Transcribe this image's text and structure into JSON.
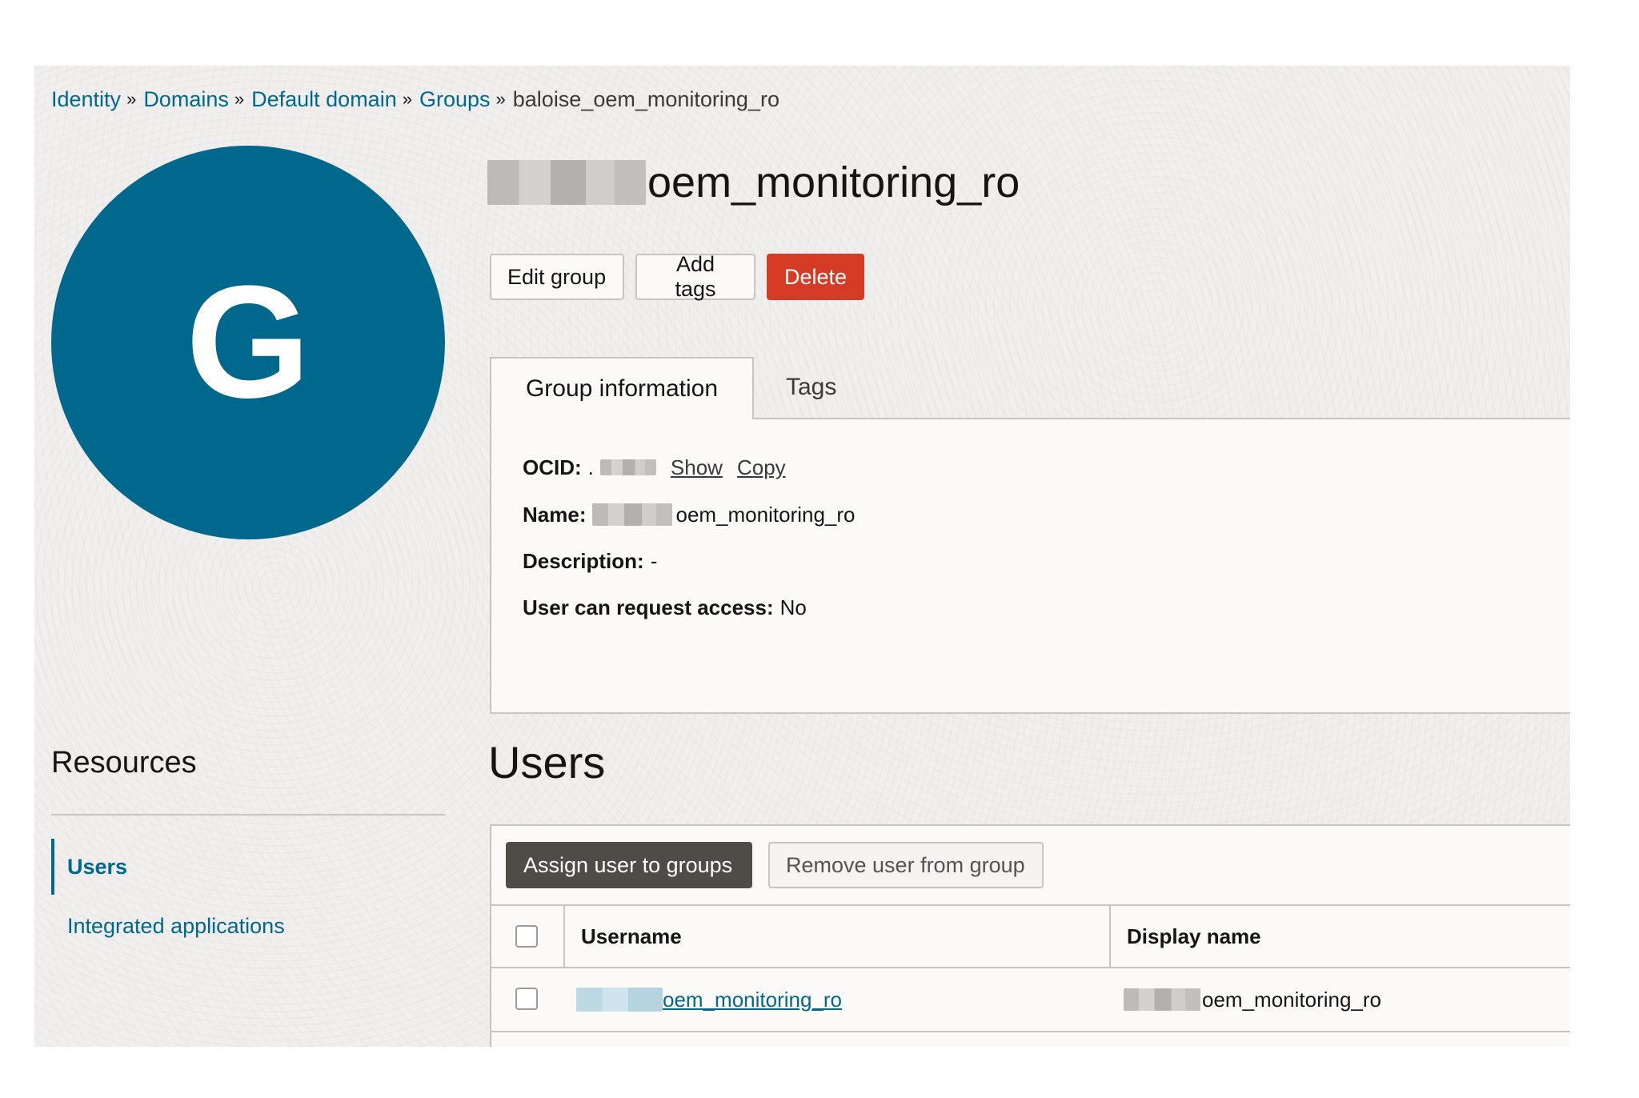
{
  "breadcrumb": {
    "items": [
      "Identity",
      "Domains",
      "Default domain",
      "Groups"
    ],
    "current": "baloise_oem_monitoring_ro",
    "separator": "»"
  },
  "avatar": {
    "letter": "G",
    "color": "#00688c"
  },
  "group": {
    "title_visible": "oem_monitoring_ro"
  },
  "actions": {
    "edit_label": "Edit group",
    "tags_label": "Add tags",
    "delete_label": "Delete"
  },
  "tabs": [
    {
      "label": "Group information",
      "active": true
    },
    {
      "label": "Tags",
      "active": false
    }
  ],
  "info": {
    "ocid_label": "OCID:",
    "ocid_value": ".",
    "show_label": "Show",
    "copy_label": "Copy",
    "name_label": "Name:",
    "name_value": "oem_monitoring_ro",
    "description_label": "Description:",
    "description_value": "-",
    "request_label": "User can request access:",
    "request_value": "No"
  },
  "resources": {
    "title": "Resources",
    "items": [
      "Users",
      "Integrated applications"
    ]
  },
  "users": {
    "title": "Users",
    "assign_label": "Assign user to groups",
    "remove_label": "Remove user from group",
    "columns": [
      "Username",
      "Display name"
    ],
    "rows": [
      {
        "username": "oem_monitoring_ro",
        "display_name": "oem_monitoring_ro"
      }
    ]
  },
  "colors": {
    "accent": "#00688c",
    "danger": "#d63b25",
    "dark_button": "#4f4b47"
  }
}
